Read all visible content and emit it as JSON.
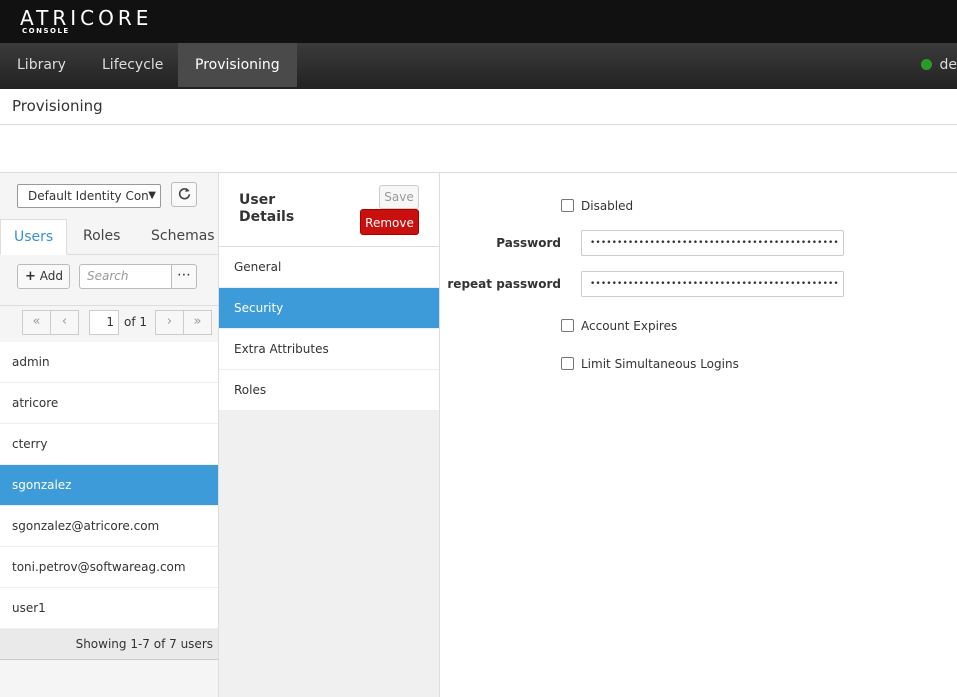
{
  "header": {
    "logo_main": "ATRICORE",
    "logo_sub": "CONSOLE"
  },
  "nav": {
    "items": [
      {
        "label": "Library"
      },
      {
        "label": "Lifecycle"
      },
      {
        "label": "Provisioning",
        "active": true
      }
    ],
    "user_label": "de",
    "status_color": "#2b9a2b"
  },
  "page": {
    "title": "Provisioning"
  },
  "left": {
    "identity_select": "Default Identity Con",
    "tabs": [
      {
        "label": "Users",
        "active": true
      },
      {
        "label": "Roles"
      },
      {
        "label": "Schemas"
      }
    ],
    "add_label": "Add",
    "search_placeholder": "Search",
    "pager": {
      "current_page": "1",
      "of_label": "of 1"
    },
    "users": [
      {
        "name": "admin"
      },
      {
        "name": "atricore"
      },
      {
        "name": "cterry"
      },
      {
        "name": "sgonzalez",
        "selected": true
      },
      {
        "name": "sgonzalez@atricore.com"
      },
      {
        "name": "toni.petrov@softwareag.com"
      },
      {
        "name": "user1"
      }
    ],
    "footer": "Showing 1-7 of 7 users"
  },
  "details": {
    "title": "User Details",
    "save_label": "Save",
    "remove_label": "Remove",
    "menu": [
      {
        "label": "General"
      },
      {
        "label": "Security",
        "active": true
      },
      {
        "label": "Extra Attributes"
      },
      {
        "label": "Roles"
      }
    ]
  },
  "security_form": {
    "disabled_label": "Disabled",
    "password_label": "Password",
    "password_value": "••••••••••••••••••••••••••••••••••••••••••••••",
    "repeat_label": "repeat password",
    "repeat_value": "••••••••••••••••••••••••••••••••••••••••••••••",
    "account_expires_label": "Account Expires",
    "limit_logins_label": "Limit Simultaneous Logins"
  },
  "colors": {
    "accent": "#3d9bd9",
    "danger": "#c9100f",
    "header_bg": "#111111",
    "tab_active": "#3a8fd0"
  }
}
